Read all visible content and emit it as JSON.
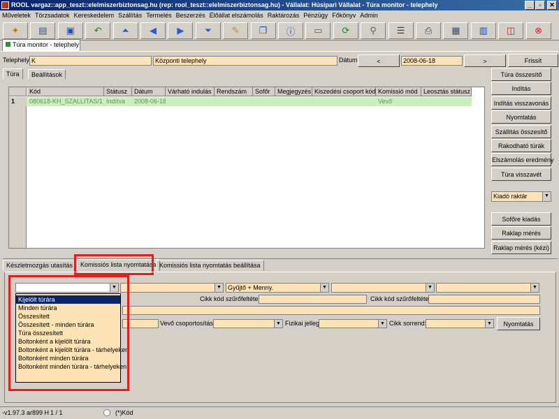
{
  "window": {
    "title": "ROOL vargaz::app_teszt::elelmiszerbiztonsag.hu (rep: rool_teszt::elelmiszerbiztonsag.hu) - Vállalat: Húsipari Vállalat - Túra monitor - telephely",
    "min": "_",
    "max": "▫",
    "close": "✕"
  },
  "menu": [
    "Műveletek",
    "Törzsadatok",
    "Kereskedelem",
    "Szállítás",
    "Termelés",
    "Beszerzés",
    "Élőállat elszámolás",
    "Raktározás",
    "Pénzügy",
    "Főkönyv",
    "Admin"
  ],
  "toolbar_icons": [
    {
      "name": "wizard-icon",
      "glyph": "✦",
      "color": "#c08000"
    },
    {
      "name": "open-icon",
      "glyph": "▤",
      "color": "#2050c0"
    },
    {
      "name": "save-icon",
      "glyph": "▣",
      "color": "#2050c0"
    },
    {
      "name": "undo-icon",
      "glyph": "↶",
      "color": "#208020"
    },
    {
      "name": "first-icon",
      "glyph": "⏶",
      "color": "#2060d0"
    },
    {
      "name": "prev-icon",
      "glyph": "◀",
      "color": "#2060d0"
    },
    {
      "name": "next-icon",
      "glyph": "▶",
      "color": "#2060d0"
    },
    {
      "name": "last-icon",
      "glyph": "⏷",
      "color": "#2060d0"
    },
    {
      "name": "edit-icon",
      "glyph": "✎",
      "color": "#c09020"
    },
    {
      "name": "copy-icon",
      "glyph": "❐",
      "color": "#2050c0"
    },
    {
      "name": "info-icon",
      "glyph": "ⓘ",
      "color": "#2050c0"
    },
    {
      "name": "form-icon",
      "glyph": "▭",
      "color": "#606060"
    },
    {
      "name": "refresh-icon",
      "glyph": "⟳",
      "color": "#208020"
    },
    {
      "name": "search-icon",
      "glyph": "⚲",
      "color": "#606060"
    },
    {
      "name": "grid-icon",
      "glyph": "☰",
      "color": "#404040"
    },
    {
      "name": "print-icon",
      "glyph": "⎙",
      "color": "#404040"
    },
    {
      "name": "table-icon",
      "glyph": "▦",
      "color": "#2050a0"
    },
    {
      "name": "columns-icon",
      "glyph": "▥",
      "color": "#2050a0"
    },
    {
      "name": "window-icon",
      "glyph": "◫",
      "color": "#c02020"
    },
    {
      "name": "exit-icon",
      "glyph": "⊗",
      "color": "#e02020"
    }
  ],
  "doc_tab": "Túra monitor - telephely",
  "header": {
    "telephely_label": "Telephely:",
    "telephely_code": "K",
    "telephely_name": "Központi telephely",
    "datum_label": "Dátum:",
    "prev": "<",
    "date": "2008-06-18",
    "next": ">",
    "refresh": "Frissít"
  },
  "tabs_top": [
    "Túra",
    "Beállítások"
  ],
  "grid": {
    "columns": [
      "Kód",
      "Státusz",
      "Dátum",
      "Várható indulás",
      "Rendszám",
      "Sofőr",
      "Megjegyzés",
      "Kiszedési csoport kód",
      "Komissió mód",
      "Leosztás státusz"
    ],
    "rows": [
      {
        "num": "1",
        "cells": [
          "080618-KH_SZALLITAS/1",
          "Indítva",
          "2008-06-18",
          "",
          "",
          "",
          "",
          "",
          "Vevő",
          ""
        ]
      }
    ]
  },
  "right_buttons": [
    "Túra összesítő",
    "Indítás",
    "Indítás visszavonás",
    "Nyomtatás",
    "Szállítás összesítő",
    "Rakodható túrák",
    "Elszámolás eredmény",
    "Túra visszavét"
  ],
  "kiado_raktar": "Kiadó raktár",
  "right_buttons2": [
    "Sofőre kiadás",
    "Raklap mérés",
    "Raklap mérés (kézi)"
  ],
  "tabs_bottom": [
    "Készletmozgás utasítás",
    "Komissiós lista nyomtatása",
    "Komissiós lista nyomtatás beállítása"
  ],
  "print": {
    "combo2": "",
    "combo3": "Gyűjtő + Menny.",
    "cikk_szuro_label": "Cikk kód szűrőfeltétel:",
    "cikk_szuro_label2": "Cikk kód szűrőfeltétel:",
    "vevo_label": "Vevő csoportosítás:",
    "fizikai_label": "Fizikai jelleg:",
    "sorrend_label": "Cikk sorrend:",
    "nyomtatas": "Nyomtatás",
    "dropdown": [
      "Kijelölt túrára",
      "Minden túrára",
      "Összesített",
      "Összesített - minden túrára",
      "Túra összesített",
      "Boltonként a kijelölt túrára",
      "Boltonként a kijelölt túrára - tárhelyeken",
      "Boltonként minden túrára",
      "Boltonként minden túrára - tárhelyeken"
    ]
  },
  "status": {
    "version": "-v1.97.3 ar899 H",
    "page": "1 / 1",
    "kod": "(*)Kód"
  }
}
